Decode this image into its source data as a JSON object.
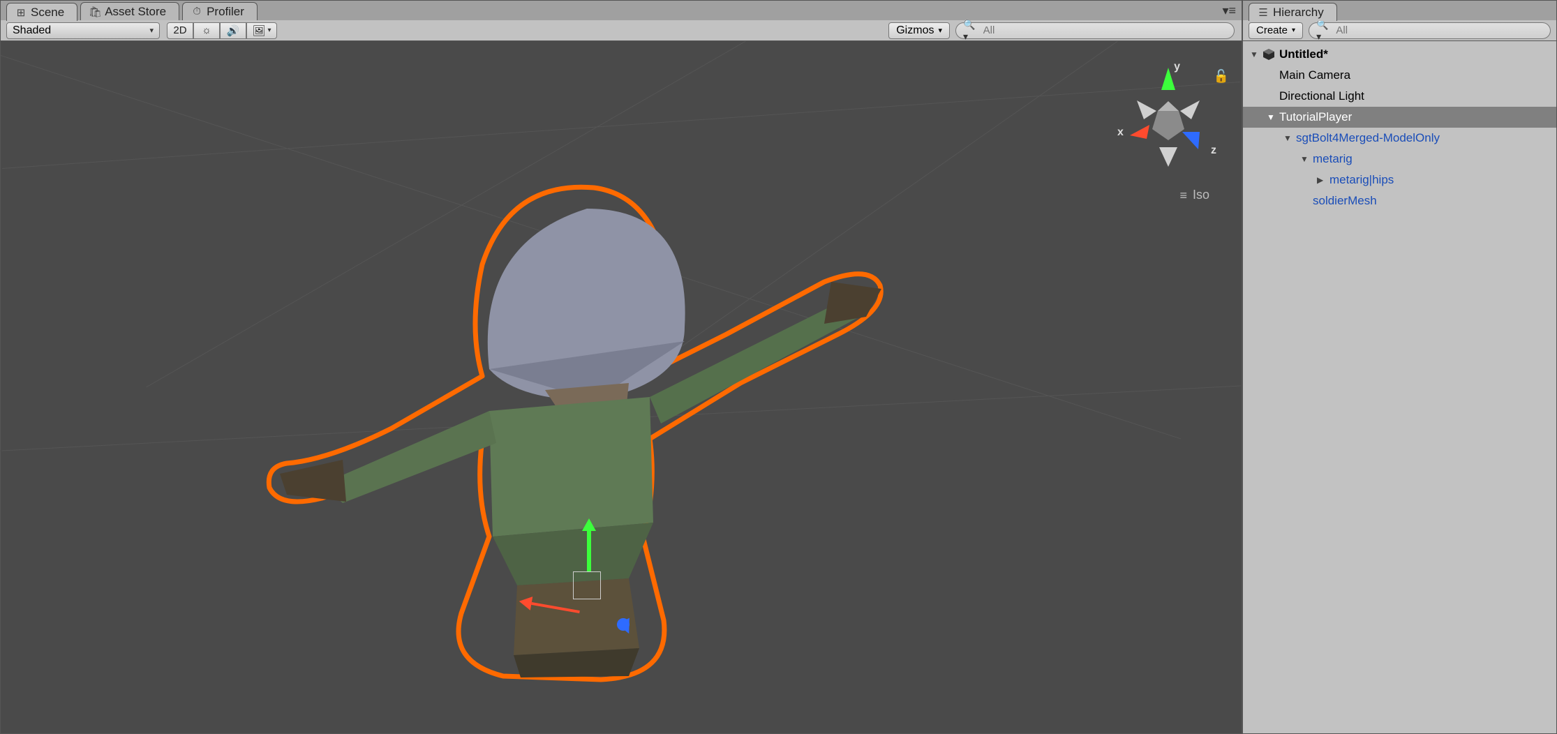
{
  "scene": {
    "tabs": [
      {
        "label": "Scene",
        "icon": "⊞"
      },
      {
        "label": "Asset Store",
        "icon": "🛍"
      },
      {
        "label": "Profiler",
        "icon": "⏱"
      }
    ],
    "active_tab": 0,
    "shading_mode": "Shaded",
    "toolbar": {
      "btn_2d": "2D"
    },
    "gizmos_label": "Gizmos",
    "search_placeholder": "All",
    "axis_labels": {
      "x": "x",
      "y": "y",
      "z": "z"
    },
    "projection_label": "Iso",
    "colors": {
      "selection_outline": "#ff6a00",
      "axis_x": "#ff4b2e",
      "axis_y": "#3cff3c",
      "axis_z": "#2e6bff"
    }
  },
  "hierarchy": {
    "tab_label": "Hierarchy",
    "create_label": "Create",
    "search_placeholder": "All",
    "scene_name": "Untitled*",
    "items": {
      "main_camera": "Main Camera",
      "directional_light": "Directional Light",
      "tutorial_player": "TutorialPlayer",
      "model": "sgtBolt4Merged-ModelOnly",
      "metarig": "metarig",
      "hips": "metarig|hips",
      "soldier_mesh": "soldierMesh"
    },
    "selected": "tutorial_player"
  }
}
